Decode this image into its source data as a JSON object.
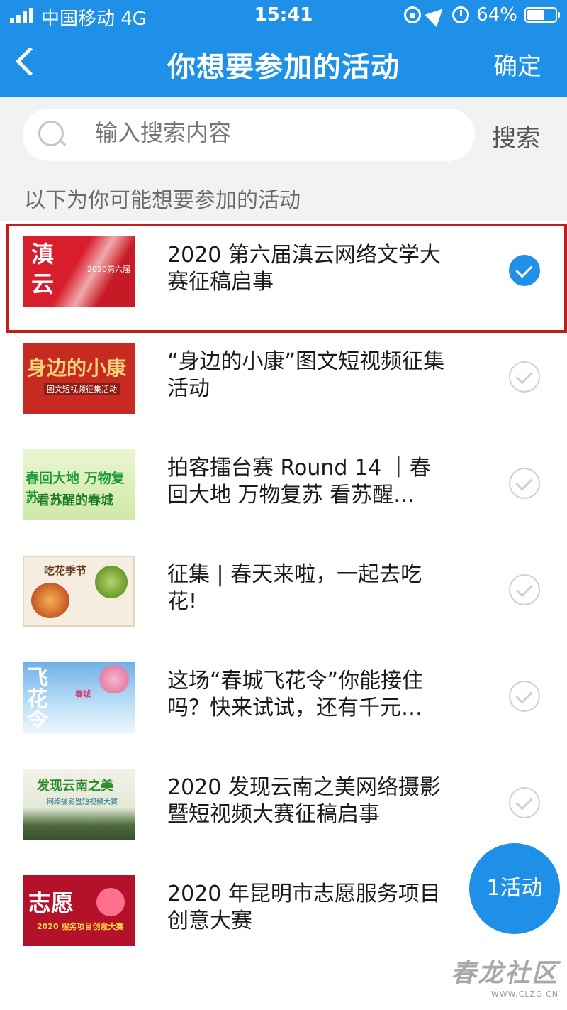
{
  "status_bar": {
    "carrier": "中国移动  4G",
    "time": "15:41",
    "battery_text": "64%",
    "battery_level": 0.64,
    "icons": [
      "signal-icon",
      "orientation-lock-icon",
      "location-icon",
      "alarm-icon",
      "battery-icon"
    ]
  },
  "nav": {
    "back_icon": "chevron-left-icon",
    "title": "你想要参加的活动",
    "confirm_label": "确定"
  },
  "search": {
    "placeholder": "输入搜索内容",
    "button_label": "搜索",
    "icon": "search-icon"
  },
  "hint_text": "以下为你可能想要参加的活动",
  "items": [
    {
      "title": "2020 第六届滇云网络文学大赛征稿启事",
      "selected": true,
      "thumb": {
        "big": "滇云",
        "small": "2020第六届"
      }
    },
    {
      "title": "“身边的小康”图文短视频征集活动",
      "selected": false,
      "thumb": {
        "big": "身边的小康",
        "small": "图文短视频征集活动"
      }
    },
    {
      "title": "拍客擂台赛 Round 14 ｜春回大地 万物复苏 看苏醒…",
      "selected": false,
      "thumb": {
        "big": "春回大地 万物复苏",
        "small": "看苏醒的春城"
      }
    },
    {
      "title": "征集 | 春天来啦，一起去吃花!",
      "selected": false,
      "thumb": {
        "big": "吃花季节",
        "small": ""
      }
    },
    {
      "title": "这场“春城飞花令”你能接住吗？快来试试，还有千元…",
      "selected": false,
      "thumb": {
        "big": "飞花令",
        "small": "春城"
      }
    },
    {
      "title": "2020 发现云南之美网络摄影暨短视频大赛征稿启事",
      "selected": false,
      "thumb": {
        "big": "发现云南之美",
        "small": "网络摄影暨短视频大赛"
      }
    },
    {
      "title": "2020 年昆明市志愿服务项目创意大赛",
      "selected": false,
      "thumb": {
        "big": "志愿",
        "small": "2020 服务项目创意大赛"
      }
    }
  ],
  "fab_label": "1活动",
  "watermark": {
    "big": "春龙社区",
    "small": "WWW.CLZG.CN"
  },
  "colors": {
    "accent": "#1e90e8",
    "selected_border": "#c0201c"
  }
}
